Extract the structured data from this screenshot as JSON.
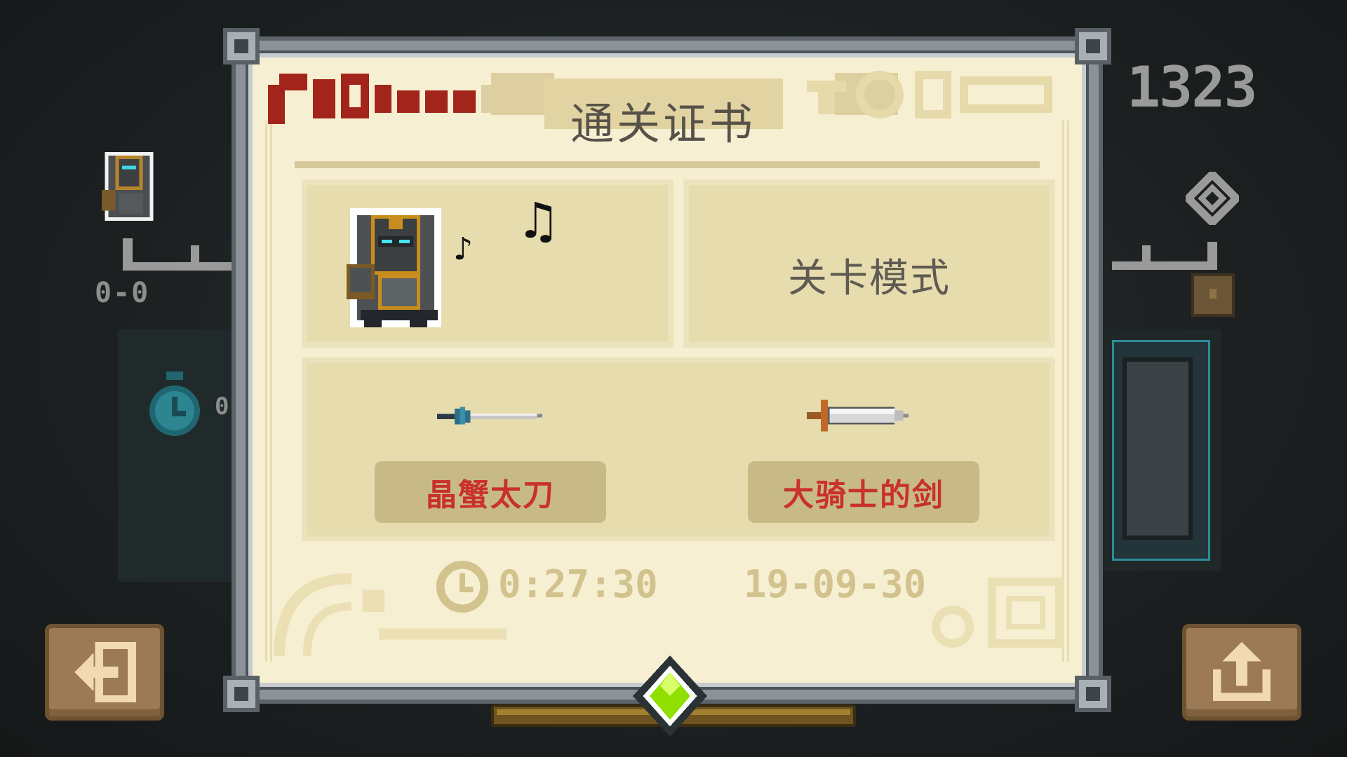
{
  "background": {
    "coins": "1323",
    "level": "0-0",
    "timer_digit": "0"
  },
  "certificate": {
    "title": "通关证书",
    "mode": "关卡模式",
    "weapons": [
      {
        "label": "晶蟹太刀"
      },
      {
        "label": "大骑士的剑"
      }
    ],
    "time": "0:27:30",
    "date": "19-09-30"
  },
  "buttons": {
    "exit_icon": "exit-icon",
    "share_icon": "share-icon"
  },
  "colors": {
    "paper": "#f6efd2",
    "panel": "#e6dcae",
    "weapon_label_text": "#c9312a",
    "gem": "#8fe000"
  }
}
